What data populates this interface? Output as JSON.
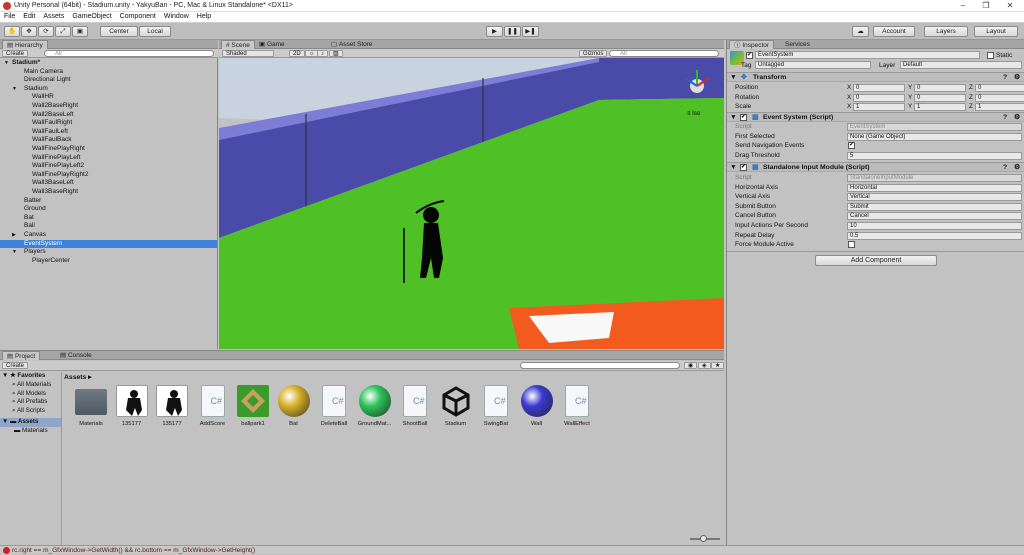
{
  "window": {
    "title": "Unity Personal (64bit) - Stadium.unity - YakyuBan - PC, Mac & Linux Standalone* <DX11>"
  },
  "menu": [
    "File",
    "Edit",
    "Assets",
    "GameObject",
    "Component",
    "Window",
    "Help"
  ],
  "toolbar": {
    "pivot": "Center",
    "space": "Local",
    "account": "Account",
    "layers": "Layers",
    "layout": "Layout"
  },
  "hierarchy": {
    "tab": "Hierarchy",
    "create": "Create",
    "search_placeholder": "All",
    "rows": [
      {
        "label": "Stadium*",
        "indent": 0,
        "arrow": "▼",
        "bold": true
      },
      {
        "label": "Main Camera",
        "indent": 1
      },
      {
        "label": "Directional Light",
        "indent": 1
      },
      {
        "label": "Stadium",
        "indent": 1,
        "arrow": "▼"
      },
      {
        "label": "WallHR",
        "indent": 2
      },
      {
        "label": "Wall2BaseRight",
        "indent": 2
      },
      {
        "label": "Wall2BaseLeft",
        "indent": 2
      },
      {
        "label": "WallFaulRight",
        "indent": 2
      },
      {
        "label": "WallFaulLeft",
        "indent": 2
      },
      {
        "label": "WallFaulBack",
        "indent": 2
      },
      {
        "label": "WallFinePlayRight",
        "indent": 2
      },
      {
        "label": "WallFinePlayLeft",
        "indent": 2
      },
      {
        "label": "WallFinePlayLeft2",
        "indent": 2
      },
      {
        "label": "WallFinePlayRight2",
        "indent": 2
      },
      {
        "label": "Wall3BaseLeft",
        "indent": 2
      },
      {
        "label": "Wall3BaseRight",
        "indent": 2
      },
      {
        "label": "Batter",
        "indent": 1
      },
      {
        "label": "Ground",
        "indent": 1
      },
      {
        "label": "Bat",
        "indent": 1
      },
      {
        "label": "Ball",
        "indent": 1
      },
      {
        "label": "Canvas",
        "indent": 1,
        "arrow": "▶"
      },
      {
        "label": "EventSystem",
        "indent": 1,
        "selected": true
      },
      {
        "label": "Players",
        "indent": 1,
        "arrow": "▼"
      },
      {
        "label": "PlayerCenter",
        "indent": 2
      }
    ]
  },
  "scene": {
    "tabs": [
      "Scene",
      "Game",
      "Asset Store"
    ],
    "shading": "Shaded",
    "mode2d": "2D",
    "gizmos": "Gizmos",
    "search_placeholder": "All",
    "persp": "≡ Iso",
    "colors": {
      "sky": "#c9d3df",
      "wall": "#4a4aa8",
      "grass": "#4fc126",
      "base": "#f25a1e"
    }
  },
  "inspector": {
    "tabs": [
      "Inspector",
      "Services"
    ],
    "object_name": "EventSystem",
    "static": "Static",
    "tag_label": "Tag",
    "tag": "Untagged",
    "layer_label": "Layer",
    "layer": "Default",
    "transform": {
      "title": "Transform",
      "rows": [
        {
          "label": "Position",
          "x": "0",
          "y": "0",
          "z": "0"
        },
        {
          "label": "Rotation",
          "x": "0",
          "y": "0",
          "z": "0"
        },
        {
          "label": "Scale",
          "x": "1",
          "y": "1",
          "z": "1"
        }
      ]
    },
    "event_system": {
      "title": "Event System (Script)",
      "rows": [
        {
          "label": "Script",
          "value": "EventSystem"
        },
        {
          "label": "First Selected",
          "value": "None (Game Object)"
        },
        {
          "label": "Send Navigation Events",
          "value": "✔"
        },
        {
          "label": "Drag Threshold",
          "value": "5"
        }
      ]
    },
    "input_module": {
      "title": "Standalone Input Module (Script)",
      "rows": [
        {
          "label": "Script",
          "value": "StandaloneInputModule"
        },
        {
          "label": "Horizontal Axis",
          "value": "Horizontal"
        },
        {
          "label": "Vertical Axis",
          "value": "Vertical"
        },
        {
          "label": "Submit Button",
          "value": "Submit"
        },
        {
          "label": "Cancel Button",
          "value": "Cancel"
        },
        {
          "label": "Input Actions Per Second",
          "value": "10"
        },
        {
          "label": "Repeat Delay",
          "value": "0.5"
        },
        {
          "label": "Force Module Active",
          "value": ""
        }
      ]
    },
    "add_component": "Add Component"
  },
  "project": {
    "tabs": [
      "Project",
      "Console"
    ],
    "create": "Create",
    "favorites": {
      "title": "Favorites",
      "items": [
        "All Materials",
        "All Models",
        "All Prefabs",
        "All Scripts"
      ]
    },
    "assets_tree": {
      "title": "Assets",
      "items": [
        "Materials"
      ]
    },
    "breadcrumb": "Assets ▸",
    "assets": [
      {
        "name": "Materials",
        "kind": "folder"
      },
      {
        "name": "135177",
        "kind": "player"
      },
      {
        "name": "135177",
        "kind": "player"
      },
      {
        "name": "AddScore",
        "kind": "script"
      },
      {
        "name": "ballpark1",
        "kind": "field"
      },
      {
        "name": "Bat",
        "kind": "sphere",
        "color": "#d8b02a"
      },
      {
        "name": "DeleteBall",
        "kind": "script"
      },
      {
        "name": "GroundMat...",
        "kind": "sphere",
        "color": "#2cc45a"
      },
      {
        "name": "ShootBall",
        "kind": "script"
      },
      {
        "name": "Stadium",
        "kind": "unity"
      },
      {
        "name": "SwingBat",
        "kind": "script"
      },
      {
        "name": "Wall",
        "kind": "sphere",
        "color": "#3a3ad0"
      },
      {
        "name": "WallEffect",
        "kind": "script"
      }
    ]
  },
  "status": {
    "message": "rc.right == m_GfxWindow->GetWidth() && rc.bottom == m_GfxWindow->GetHeight()"
  }
}
